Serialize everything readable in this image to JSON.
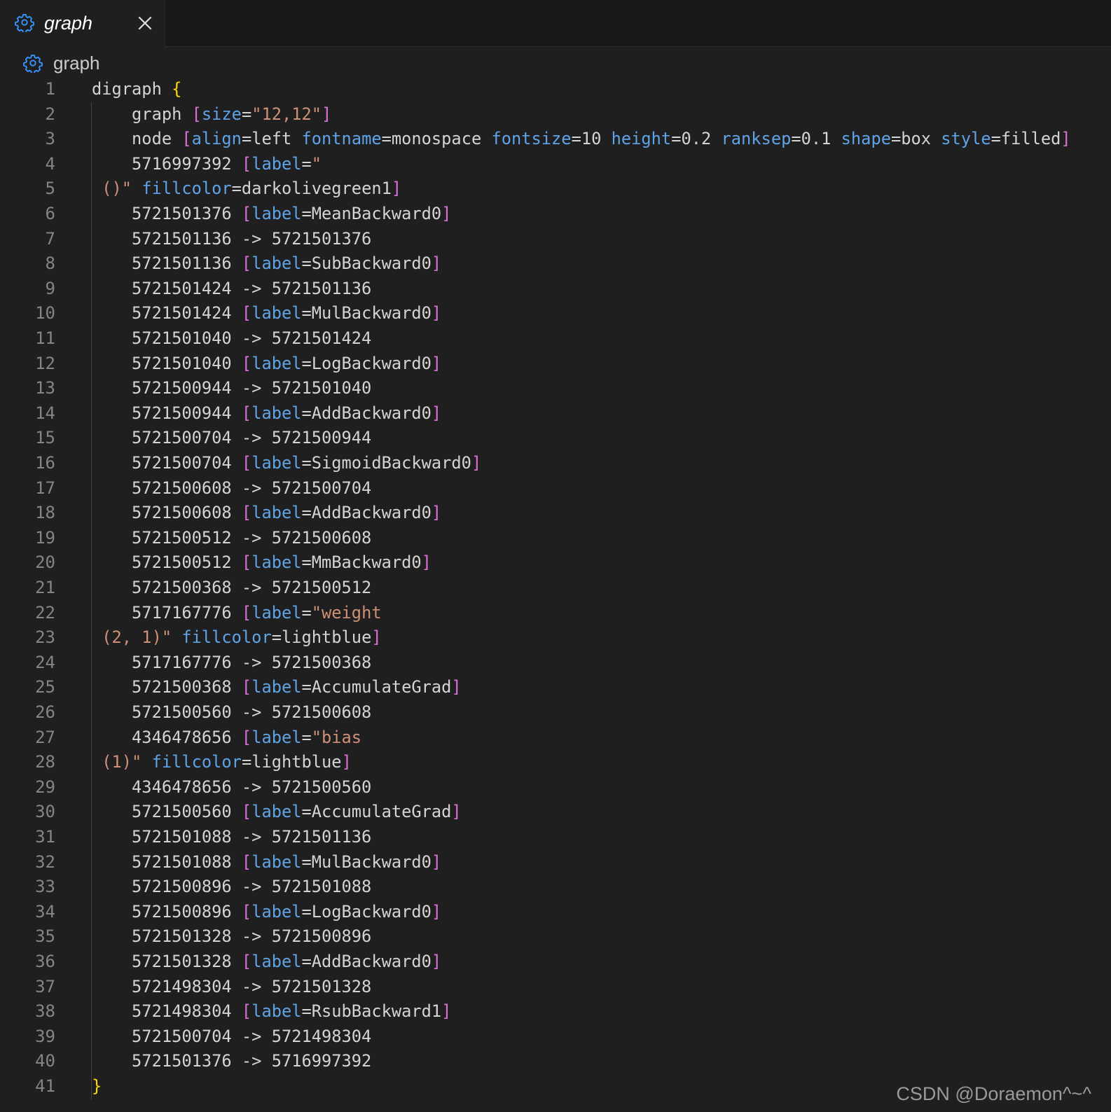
{
  "tab": {
    "title": "graph",
    "icon": "gear-icon"
  },
  "breadcrumb": {
    "label": "graph",
    "icon": "gear-icon"
  },
  "colors": {
    "keyword_brace": "#ffd700",
    "bracket": "#da70d6",
    "attribute": "#5fa3e8",
    "string": "#ce9178",
    "text": "#d4d4d4"
  },
  "lines": [
    {
      "n": "1",
      "tokens": [
        {
          "t": "digraph "
        },
        {
          "t": "{",
          "c": "k"
        }
      ]
    },
    {
      "n": "2",
      "tokens": [
        {
          "t": "    graph "
        },
        {
          "t": "[",
          "c": "b"
        },
        {
          "t": "size",
          "c": "a"
        },
        {
          "t": "="
        },
        {
          "t": "\"12,12\"",
          "c": "s"
        },
        {
          "t": "]",
          "c": "b"
        }
      ]
    },
    {
      "n": "3",
      "tokens": [
        {
          "t": "    node "
        },
        {
          "t": "[",
          "c": "b"
        },
        {
          "t": "align",
          "c": "a"
        },
        {
          "t": "=left "
        },
        {
          "t": "fontname",
          "c": "a"
        },
        {
          "t": "=monospace "
        },
        {
          "t": "fontsize",
          "c": "a"
        },
        {
          "t": "=10 "
        },
        {
          "t": "height",
          "c": "a"
        },
        {
          "t": "=0.2 "
        },
        {
          "t": "ranksep",
          "c": "a"
        },
        {
          "t": "=0.1 "
        },
        {
          "t": "shape",
          "c": "a"
        },
        {
          "t": "=box "
        },
        {
          "t": "style",
          "c": "a"
        },
        {
          "t": "=filled"
        },
        {
          "t": "]",
          "c": "b"
        }
      ]
    },
    {
      "n": "4",
      "tokens": [
        {
          "t": "    5716997392 "
        },
        {
          "t": "[",
          "c": "b"
        },
        {
          "t": "label",
          "c": "a"
        },
        {
          "t": "="
        },
        {
          "t": "\"",
          "c": "s"
        }
      ]
    },
    {
      "n": "5",
      "tokens": [
        {
          "t": " ()\"",
          "c": "s"
        },
        {
          "t": " "
        },
        {
          "t": "fillcolor",
          "c": "a"
        },
        {
          "t": "=darkolivegreen1"
        },
        {
          "t": "]",
          "c": "b"
        }
      ]
    },
    {
      "n": "6",
      "tokens": [
        {
          "t": "    5721501376 "
        },
        {
          "t": "[",
          "c": "b"
        },
        {
          "t": "label",
          "c": "a"
        },
        {
          "t": "=MeanBackward0"
        },
        {
          "t": "]",
          "c": "b"
        }
      ]
    },
    {
      "n": "7",
      "tokens": [
        {
          "t": "    5721501136 -> 5721501376"
        }
      ]
    },
    {
      "n": "8",
      "tokens": [
        {
          "t": "    5721501136 "
        },
        {
          "t": "[",
          "c": "b"
        },
        {
          "t": "label",
          "c": "a"
        },
        {
          "t": "=SubBackward0"
        },
        {
          "t": "]",
          "c": "b"
        }
      ]
    },
    {
      "n": "9",
      "tokens": [
        {
          "t": "    5721501424 -> 5721501136"
        }
      ]
    },
    {
      "n": "10",
      "tokens": [
        {
          "t": "    5721501424 "
        },
        {
          "t": "[",
          "c": "b"
        },
        {
          "t": "label",
          "c": "a"
        },
        {
          "t": "=MulBackward0"
        },
        {
          "t": "]",
          "c": "b"
        }
      ]
    },
    {
      "n": "11",
      "tokens": [
        {
          "t": "    5721501040 -> 5721501424"
        }
      ]
    },
    {
      "n": "12",
      "tokens": [
        {
          "t": "    5721501040 "
        },
        {
          "t": "[",
          "c": "b"
        },
        {
          "t": "label",
          "c": "a"
        },
        {
          "t": "=LogBackward0"
        },
        {
          "t": "]",
          "c": "b"
        }
      ]
    },
    {
      "n": "13",
      "tokens": [
        {
          "t": "    5721500944 -> 5721501040"
        }
      ]
    },
    {
      "n": "14",
      "tokens": [
        {
          "t": "    5721500944 "
        },
        {
          "t": "[",
          "c": "b"
        },
        {
          "t": "label",
          "c": "a"
        },
        {
          "t": "=AddBackward0"
        },
        {
          "t": "]",
          "c": "b"
        }
      ]
    },
    {
      "n": "15",
      "tokens": [
        {
          "t": "    5721500704 -> 5721500944"
        }
      ]
    },
    {
      "n": "16",
      "tokens": [
        {
          "t": "    5721500704 "
        },
        {
          "t": "[",
          "c": "b"
        },
        {
          "t": "label",
          "c": "a"
        },
        {
          "t": "=SigmoidBackward0"
        },
        {
          "t": "]",
          "c": "b"
        }
      ]
    },
    {
      "n": "17",
      "tokens": [
        {
          "t": "    5721500608 -> 5721500704"
        }
      ]
    },
    {
      "n": "18",
      "tokens": [
        {
          "t": "    5721500608 "
        },
        {
          "t": "[",
          "c": "b"
        },
        {
          "t": "label",
          "c": "a"
        },
        {
          "t": "=AddBackward0"
        },
        {
          "t": "]",
          "c": "b"
        }
      ]
    },
    {
      "n": "19",
      "tokens": [
        {
          "t": "    5721500512 -> 5721500608"
        }
      ]
    },
    {
      "n": "20",
      "tokens": [
        {
          "t": "    5721500512 "
        },
        {
          "t": "[",
          "c": "b"
        },
        {
          "t": "label",
          "c": "a"
        },
        {
          "t": "=MmBackward0"
        },
        {
          "t": "]",
          "c": "b"
        }
      ]
    },
    {
      "n": "21",
      "tokens": [
        {
          "t": "    5721500368 -> 5721500512"
        }
      ]
    },
    {
      "n": "22",
      "tokens": [
        {
          "t": "    5717167776 "
        },
        {
          "t": "[",
          "c": "b"
        },
        {
          "t": "label",
          "c": "a"
        },
        {
          "t": "="
        },
        {
          "t": "\"weight",
          "c": "s"
        }
      ]
    },
    {
      "n": "23",
      "tokens": [
        {
          "t": " (2, 1)\"",
          "c": "s"
        },
        {
          "t": " "
        },
        {
          "t": "fillcolor",
          "c": "a"
        },
        {
          "t": "=lightblue"
        },
        {
          "t": "]",
          "c": "b"
        }
      ]
    },
    {
      "n": "24",
      "tokens": [
        {
          "t": "    5717167776 -> 5721500368"
        }
      ]
    },
    {
      "n": "25",
      "tokens": [
        {
          "t": "    5721500368 "
        },
        {
          "t": "[",
          "c": "b"
        },
        {
          "t": "label",
          "c": "a"
        },
        {
          "t": "=AccumulateGrad"
        },
        {
          "t": "]",
          "c": "b"
        }
      ]
    },
    {
      "n": "26",
      "tokens": [
        {
          "t": "    5721500560 -> 5721500608"
        }
      ]
    },
    {
      "n": "27",
      "tokens": [
        {
          "t": "    4346478656 "
        },
        {
          "t": "[",
          "c": "b"
        },
        {
          "t": "label",
          "c": "a"
        },
        {
          "t": "="
        },
        {
          "t": "\"bias",
          "c": "s"
        }
      ]
    },
    {
      "n": "28",
      "tokens": [
        {
          "t": " (1)\"",
          "c": "s"
        },
        {
          "t": " "
        },
        {
          "t": "fillcolor",
          "c": "a"
        },
        {
          "t": "=lightblue"
        },
        {
          "t": "]",
          "c": "b"
        }
      ]
    },
    {
      "n": "29",
      "tokens": [
        {
          "t": "    4346478656 -> 5721500560"
        }
      ]
    },
    {
      "n": "30",
      "tokens": [
        {
          "t": "    5721500560 "
        },
        {
          "t": "[",
          "c": "b"
        },
        {
          "t": "label",
          "c": "a"
        },
        {
          "t": "=AccumulateGrad"
        },
        {
          "t": "]",
          "c": "b"
        }
      ]
    },
    {
      "n": "31",
      "tokens": [
        {
          "t": "    5721501088 -> 5721501136"
        }
      ]
    },
    {
      "n": "32",
      "tokens": [
        {
          "t": "    5721501088 "
        },
        {
          "t": "[",
          "c": "b"
        },
        {
          "t": "label",
          "c": "a"
        },
        {
          "t": "=MulBackward0"
        },
        {
          "t": "]",
          "c": "b"
        }
      ]
    },
    {
      "n": "33",
      "tokens": [
        {
          "t": "    5721500896 -> 5721501088"
        }
      ]
    },
    {
      "n": "34",
      "tokens": [
        {
          "t": "    5721500896 "
        },
        {
          "t": "[",
          "c": "b"
        },
        {
          "t": "label",
          "c": "a"
        },
        {
          "t": "=LogBackward0"
        },
        {
          "t": "]",
          "c": "b"
        }
      ]
    },
    {
      "n": "35",
      "tokens": [
        {
          "t": "    5721501328 -> 5721500896"
        }
      ]
    },
    {
      "n": "36",
      "tokens": [
        {
          "t": "    5721501328 "
        },
        {
          "t": "[",
          "c": "b"
        },
        {
          "t": "label",
          "c": "a"
        },
        {
          "t": "=AddBackward0"
        },
        {
          "t": "]",
          "c": "b"
        }
      ]
    },
    {
      "n": "37",
      "tokens": [
        {
          "t": "    5721498304 -> 5721501328"
        }
      ]
    },
    {
      "n": "38",
      "tokens": [
        {
          "t": "    5721498304 "
        },
        {
          "t": "[",
          "c": "b"
        },
        {
          "t": "label",
          "c": "a"
        },
        {
          "t": "=RsubBackward1"
        },
        {
          "t": "]",
          "c": "b"
        }
      ]
    },
    {
      "n": "39",
      "tokens": [
        {
          "t": "    5721500704 -> 5721498304"
        }
      ]
    },
    {
      "n": "40",
      "tokens": [
        {
          "t": "    5721501376 -> 5716997392"
        }
      ]
    },
    {
      "n": "41",
      "tokens": [
        {
          "t": "}",
          "c": "k"
        }
      ]
    }
  ],
  "watermark": "CSDN @Doraemon^~^"
}
